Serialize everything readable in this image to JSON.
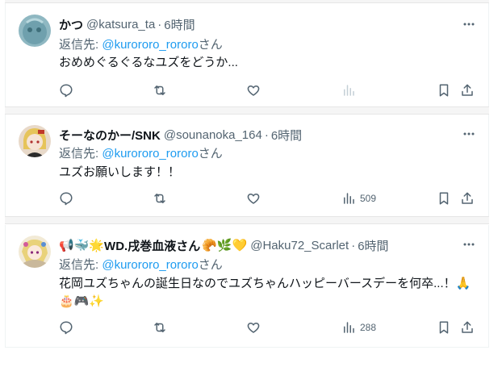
{
  "posts": [
    {
      "name": "かつ",
      "handle": "@katsura_ta",
      "dot": "·",
      "time": "6時間",
      "reply_prefix": "返信先: ",
      "reply_to": "@kurororo_rororo",
      "reply_suffix": "さん",
      "text": "おめめぐるぐるなユズをどうか...",
      "views": ""
    },
    {
      "name": "そーなのかー/SNK",
      "handle": "@sounanoka_164",
      "dot": "·",
      "time": "6時間",
      "reply_prefix": "返信先: ",
      "reply_to": "@kurororo_rororo",
      "reply_suffix": "さん",
      "text": "ユズお願いします！！",
      "views": "509"
    },
    {
      "name_emoji_before": "📢🐳🌟",
      "name": "WD.戌巻血液さん",
      "name_emoji_after": "🥐🌿💛",
      "handle": "@Haku72_Scarlet",
      "dot": "·",
      "time": "6時間",
      "reply_prefix": "返信先: ",
      "reply_to": "@kurororo_rororo",
      "reply_suffix": "さん",
      "text_line1": "花岡ユズちゃんの誕生日なのでユズちゃんハッピーバースデーを何卒...！🙏",
      "text_line2": "🎂🎮✨",
      "views": "288"
    }
  ],
  "colors": {
    "text": "#0f1419",
    "muted": "#536471",
    "link": "#1d9bf0",
    "separator": "#f5f5f5"
  },
  "icons": [
    "more-icon",
    "reply-icon",
    "retweet-icon",
    "like-icon",
    "views-icon",
    "bookmark-icon",
    "share-icon"
  ]
}
